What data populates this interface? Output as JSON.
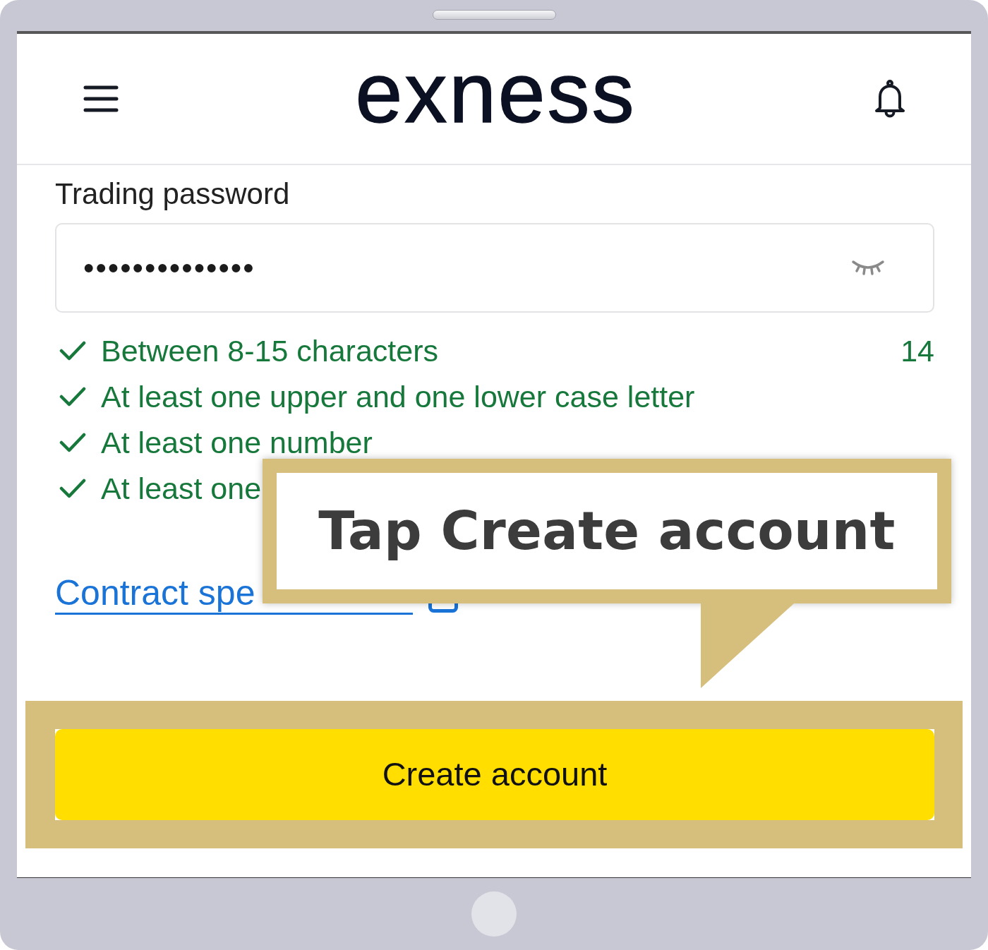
{
  "header": {
    "logo": "exness"
  },
  "password": {
    "label": "Trading password",
    "value": "••••••••••••••"
  },
  "rules": [
    {
      "text": "Between 8-15 characters",
      "met": true,
      "counter": "14"
    },
    {
      "text": "At least one upper and one lower case letter",
      "met": true
    },
    {
      "text": "At least one number",
      "met": true
    },
    {
      "text": "At least one",
      "met": true
    }
  ],
  "link": {
    "text": "Contract spe"
  },
  "tutorial_callout": {
    "text": "Tap Create account"
  },
  "button": {
    "label": "Create account",
    "highlighted": true
  }
}
